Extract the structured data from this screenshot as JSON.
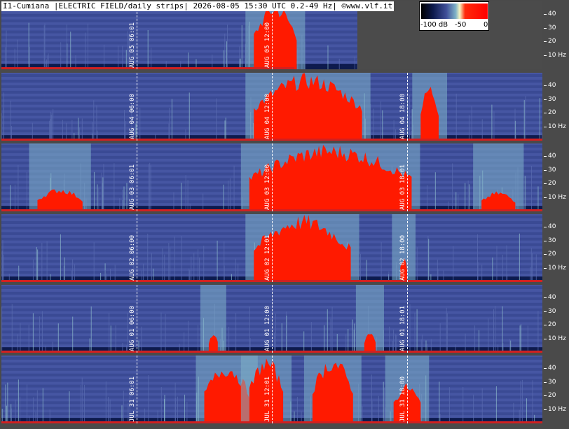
{
  "title": "I1-Cumiana |ELECTRIC FIELD/daily strips| 2026-08-05 15:30 UTC 0.2-49 Hz| ©www.vlf.it",
  "colors": {
    "background": "#3f4f99",
    "hot": "#ff0000",
    "mid": "#7fb3c8",
    "axis": "#4a4a4a"
  },
  "chart_data": {
    "type": "heatmap",
    "colorbar": {
      "min_label": "-100 dB",
      "mid_label": "-50",
      "max_label": "0",
      "range_db": [
        -100,
        0
      ]
    },
    "y_axis": {
      "unit": "Hz",
      "range": [
        0,
        49
      ],
      "tick_labels": [
        "40",
        "30",
        "20",
        "10 Hz"
      ],
      "ticks": [
        40,
        30,
        20,
        10
      ]
    },
    "strips": [
      {
        "markers": [
          {
            "label": "AUG 05  06:01",
            "hour": 6
          },
          {
            "label": "AUG 05  12:00",
            "hour": 12
          }
        ],
        "activity": [
          {
            "start": 11.2,
            "end": 13.1,
            "peak": 1.0
          }
        ],
        "data_until_hour": 13.0
      },
      {
        "markers": [
          {
            "label": "AUG 04  06:00",
            "hour": 6
          },
          {
            "label": "AUG 04  12:00",
            "hour": 12
          },
          {
            "label": "AUG 04  18:00",
            "hour": 18
          }
        ],
        "activity": [
          {
            "start": 11.2,
            "end": 16.0,
            "peak": 1.0
          },
          {
            "start": 18.6,
            "end": 19.4,
            "peak": 0.85
          }
        ]
      },
      {
        "markers": [
          {
            "label": "AUG 03  06:01",
            "hour": 6
          },
          {
            "label": "AUG 03  12:00",
            "hour": 12
          },
          {
            "label": "AUG 03  18:01",
            "hour": 18
          }
        ],
        "activity": [
          {
            "start": 1.6,
            "end": 3.6,
            "peak": 0.35
          },
          {
            "start": 11.0,
            "end": 18.2,
            "peak": 1.0
          },
          {
            "start": 21.3,
            "end": 22.8,
            "peak": 0.3
          }
        ]
      },
      {
        "markers": [
          {
            "label": "AUG 02  06:00",
            "hour": 6
          },
          {
            "label": "AUG 02  12:01",
            "hour": 12
          },
          {
            "label": "AUG 02  18:00",
            "hour": 18
          }
        ],
        "activity": [
          {
            "start": 11.2,
            "end": 15.5,
            "peak": 1.0
          },
          {
            "start": 17.7,
            "end": 18.0,
            "peak": 0.4
          }
        ]
      },
      {
        "markers": [
          {
            "label": "AUG 01  06:00",
            "hour": 6
          },
          {
            "label": "AUG 01  12:00",
            "hour": 12
          },
          {
            "label": "AUG 01  18:01",
            "hour": 18
          }
        ],
        "activity": [
          {
            "start": 9.2,
            "end": 9.6,
            "peak": 0.3
          },
          {
            "start": 16.1,
            "end": 16.6,
            "peak": 0.3
          }
        ]
      },
      {
        "markers": [
          {
            "label": "JUL 31  06:01",
            "hour": 6
          },
          {
            "label": "JUL 31  12:01",
            "hour": 12
          },
          {
            "label": "JUL 31  18:00",
            "hour": 18
          }
        ],
        "activity": [
          {
            "start": 9.0,
            "end": 11.0,
            "peak": 0.9
          },
          {
            "start": 11.0,
            "end": 12.5,
            "peak": 1.0
          },
          {
            "start": 13.8,
            "end": 15.6,
            "peak": 1.0
          },
          {
            "start": 17.4,
            "end": 18.6,
            "peak": 0.6
          }
        ]
      }
    ]
  }
}
